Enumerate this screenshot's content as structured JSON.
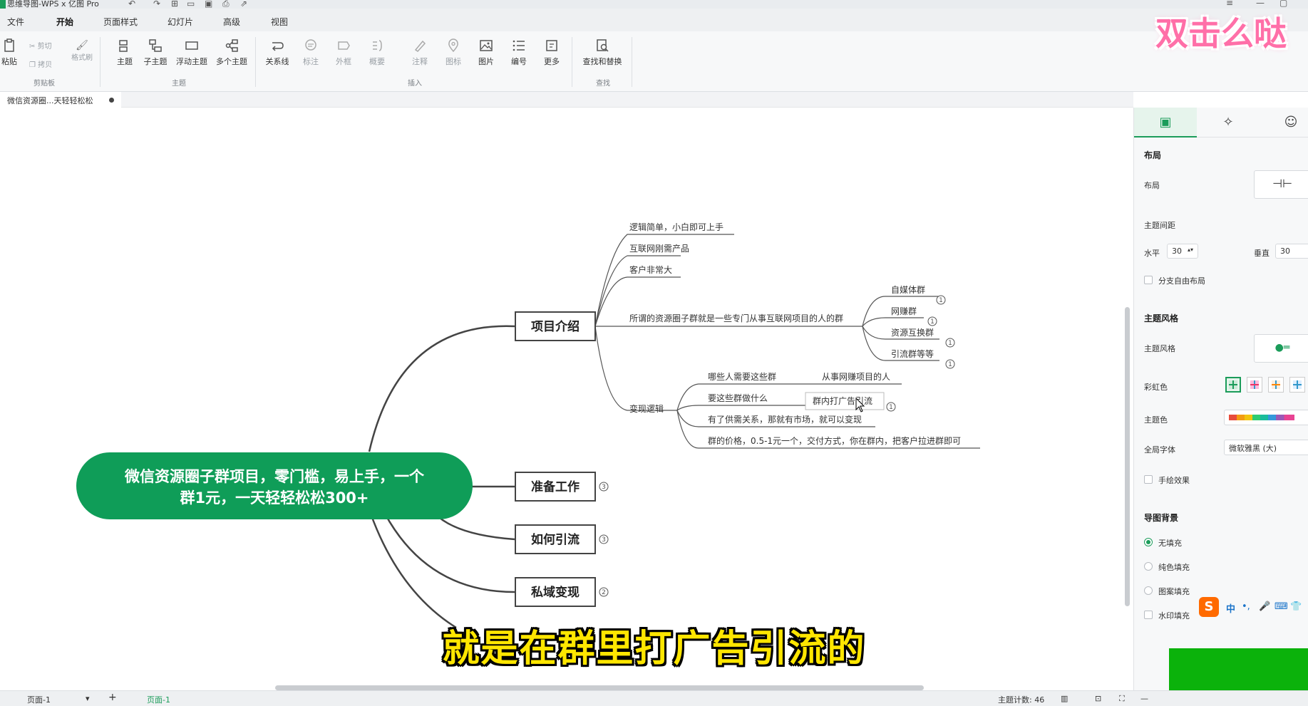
{
  "window": {
    "title": "思维导图-WPS x 亿图 Pro"
  },
  "menu": {
    "tabs": [
      "文件",
      "开始",
      "页面样式",
      "幻灯片",
      "高级",
      "视图"
    ],
    "active": "开始"
  },
  "ribbon": {
    "paste": "粘贴",
    "cut": "剪切",
    "copy": "拷贝",
    "format_painter": "格式刷",
    "group_clipboard": "剪贴板",
    "topic": "主题",
    "subtopic": "子主题",
    "floating_topic": "浮动主题",
    "multi_topic": "多个主题",
    "group_topic": "主题",
    "relation": "关系线",
    "callout": "标注",
    "boundary": "外框",
    "summary": "概要",
    "note": "注释",
    "icon": "图标",
    "image": "图片",
    "numbering": "编号",
    "more": "更多",
    "group_insert": "插入",
    "find_replace": "查找和替换",
    "group_find": "查找"
  },
  "doc_tab": {
    "name": "微信资源圈...天轻轻松松"
  },
  "mindmap": {
    "root": {
      "line1": "微信资源圈子群项目，零门槛，易上手，一个",
      "line2": "群1元，一天轻轻松松300+",
      "color": "#0f9d58"
    },
    "main_topics": [
      {
        "label": "项目介绍",
        "badge": ""
      },
      {
        "label": "准备工作",
        "badge": "3"
      },
      {
        "label": "如何引流",
        "badge": "3"
      },
      {
        "label": "私域变现",
        "badge": "2"
      }
    ],
    "intro_children": [
      "逻辑简单，小白即可上手",
      "互联网刚需产品",
      "客户非常大",
      "所谓的资源圈子群就是一些专门从事互联网项目的人的群",
      "变现逻辑"
    ],
    "group_types": [
      {
        "label": "自媒体群",
        "badge": "1"
      },
      {
        "label": "网赚群",
        "badge": "1"
      },
      {
        "label": "资源互换群",
        "badge": "1"
      },
      {
        "label": "引流群等等",
        "badge": "1"
      }
    ],
    "logic_children": [
      "哪些人需要这些群",
      "要这些群做什么",
      "有了供需关系，那就有市场，就可以变现",
      "群的价格，0.5-1元一个，交付方式，你在群内，把客户拉进群即可"
    ],
    "who_answer": "从事网赚项目的人",
    "what_answer": {
      "label": "群内打广告引流",
      "badge": "1"
    }
  },
  "right_panel": {
    "section_layout": "布局",
    "layout_label": "布局",
    "spacing_label": "主题间距",
    "horizontal_label": "水平",
    "horizontal_value": "30",
    "vertical_label": "垂直",
    "vertical_value": "30",
    "free_layout": "分支自由布局",
    "section_style": "主题风格",
    "style_label": "主题风格",
    "rainbow_label": "彩虹色",
    "theme_color_label": "主题色",
    "font_label": "全局字体",
    "font_value": "微软雅黑 (大)",
    "handdrawn": "手绘效果",
    "section_bg": "导图背景",
    "bg_options": [
      "无填充",
      "纯色填充",
      "图案填充",
      "水印填充"
    ],
    "bg_selected": "无填充"
  },
  "statusbar": {
    "page_select": "页面-1",
    "page_tab": "页面-1",
    "topic_count": "主题计数: 46"
  },
  "overlay": {
    "subtitle": "就是在群里打广告引流的",
    "sticker": "双击么哒",
    "ime_logo": "S",
    "ime_mode": "中"
  },
  "colors": {
    "accent": "#1b9c5a",
    "root_fill": "#0f9d58",
    "subtitle": "#ffe600",
    "sticker": "#ff6fa8"
  }
}
